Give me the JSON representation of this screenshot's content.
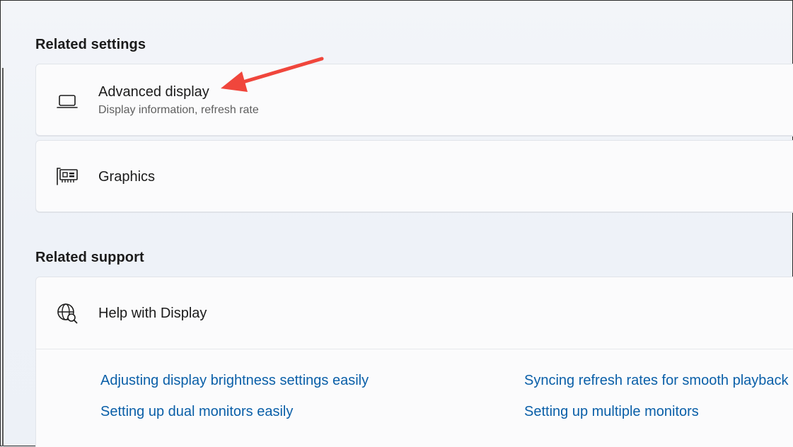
{
  "sections": {
    "related_settings": {
      "title": "Related settings",
      "items": [
        {
          "title": "Advanced display",
          "subtitle": "Display information, refresh rate",
          "icon": "laptop-icon"
        },
        {
          "title": "Graphics",
          "icon": "graphics-card-icon"
        }
      ]
    },
    "related_support": {
      "title": "Related support",
      "item": {
        "title": "Help with Display",
        "icon": "globe-search-icon"
      },
      "links": [
        "Adjusting display brightness settings easily",
        "Syncing refresh rates for smooth playback",
        "Setting up dual monitors easily",
        "Setting up multiple monitors"
      ]
    }
  },
  "annotation": {
    "type": "arrow",
    "color": "#f0463c",
    "points_to": "Advanced display"
  }
}
